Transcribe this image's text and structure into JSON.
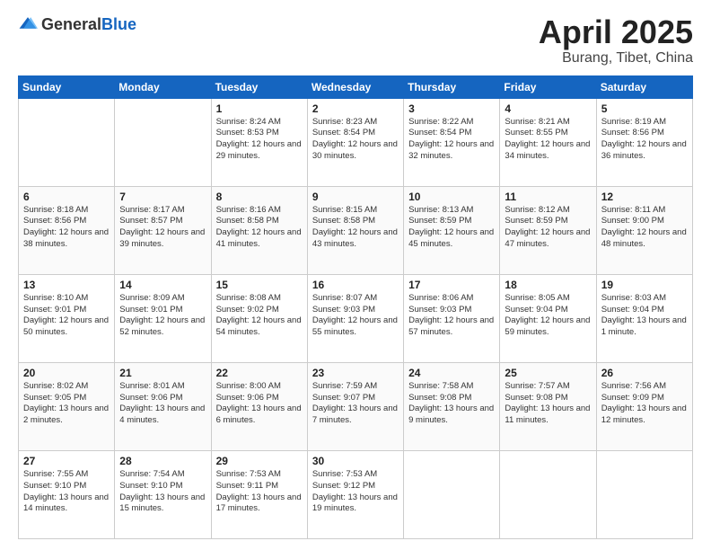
{
  "header": {
    "logo_general": "General",
    "logo_blue": "Blue",
    "title": "April 2025",
    "location": "Burang, Tibet, China"
  },
  "calendar": {
    "days_of_week": [
      "Sunday",
      "Monday",
      "Tuesday",
      "Wednesday",
      "Thursday",
      "Friday",
      "Saturday"
    ],
    "weeks": [
      [
        {
          "day": "",
          "info": ""
        },
        {
          "day": "",
          "info": ""
        },
        {
          "day": "1",
          "sunrise": "8:24 AM",
          "sunset": "8:53 PM",
          "daylight": "12 hours and 29 minutes."
        },
        {
          "day": "2",
          "sunrise": "8:23 AM",
          "sunset": "8:54 PM",
          "daylight": "12 hours and 30 minutes."
        },
        {
          "day": "3",
          "sunrise": "8:22 AM",
          "sunset": "8:54 PM",
          "daylight": "12 hours and 32 minutes."
        },
        {
          "day": "4",
          "sunrise": "8:21 AM",
          "sunset": "8:55 PM",
          "daylight": "12 hours and 34 minutes."
        },
        {
          "day": "5",
          "sunrise": "8:19 AM",
          "sunset": "8:56 PM",
          "daylight": "12 hours and 36 minutes."
        }
      ],
      [
        {
          "day": "6",
          "sunrise": "8:18 AM",
          "sunset": "8:56 PM",
          "daylight": "12 hours and 38 minutes."
        },
        {
          "day": "7",
          "sunrise": "8:17 AM",
          "sunset": "8:57 PM",
          "daylight": "12 hours and 39 minutes."
        },
        {
          "day": "8",
          "sunrise": "8:16 AM",
          "sunset": "8:58 PM",
          "daylight": "12 hours and 41 minutes."
        },
        {
          "day": "9",
          "sunrise": "8:15 AM",
          "sunset": "8:58 PM",
          "daylight": "12 hours and 43 minutes."
        },
        {
          "day": "10",
          "sunrise": "8:13 AM",
          "sunset": "8:59 PM",
          "daylight": "12 hours and 45 minutes."
        },
        {
          "day": "11",
          "sunrise": "8:12 AM",
          "sunset": "8:59 PM",
          "daylight": "12 hours and 47 minutes."
        },
        {
          "day": "12",
          "sunrise": "8:11 AM",
          "sunset": "9:00 PM",
          "daylight": "12 hours and 48 minutes."
        }
      ],
      [
        {
          "day": "13",
          "sunrise": "8:10 AM",
          "sunset": "9:01 PM",
          "daylight": "12 hours and 50 minutes."
        },
        {
          "day": "14",
          "sunrise": "8:09 AM",
          "sunset": "9:01 PM",
          "daylight": "12 hours and 52 minutes."
        },
        {
          "day": "15",
          "sunrise": "8:08 AM",
          "sunset": "9:02 PM",
          "daylight": "12 hours and 54 minutes."
        },
        {
          "day": "16",
          "sunrise": "8:07 AM",
          "sunset": "9:03 PM",
          "daylight": "12 hours and 55 minutes."
        },
        {
          "day": "17",
          "sunrise": "8:06 AM",
          "sunset": "9:03 PM",
          "daylight": "12 hours and 57 minutes."
        },
        {
          "day": "18",
          "sunrise": "8:05 AM",
          "sunset": "9:04 PM",
          "daylight": "12 hours and 59 minutes."
        },
        {
          "day": "19",
          "sunrise": "8:03 AM",
          "sunset": "9:04 PM",
          "daylight": "13 hours and 1 minute."
        }
      ],
      [
        {
          "day": "20",
          "sunrise": "8:02 AM",
          "sunset": "9:05 PM",
          "daylight": "13 hours and 2 minutes."
        },
        {
          "day": "21",
          "sunrise": "8:01 AM",
          "sunset": "9:06 PM",
          "daylight": "13 hours and 4 minutes."
        },
        {
          "day": "22",
          "sunrise": "8:00 AM",
          "sunset": "9:06 PM",
          "daylight": "13 hours and 6 minutes."
        },
        {
          "day": "23",
          "sunrise": "7:59 AM",
          "sunset": "9:07 PM",
          "daylight": "13 hours and 7 minutes."
        },
        {
          "day": "24",
          "sunrise": "7:58 AM",
          "sunset": "9:08 PM",
          "daylight": "13 hours and 9 minutes."
        },
        {
          "day": "25",
          "sunrise": "7:57 AM",
          "sunset": "9:08 PM",
          "daylight": "13 hours and 11 minutes."
        },
        {
          "day": "26",
          "sunrise": "7:56 AM",
          "sunset": "9:09 PM",
          "daylight": "13 hours and 12 minutes."
        }
      ],
      [
        {
          "day": "27",
          "sunrise": "7:55 AM",
          "sunset": "9:10 PM",
          "daylight": "13 hours and 14 minutes."
        },
        {
          "day": "28",
          "sunrise": "7:54 AM",
          "sunset": "9:10 PM",
          "daylight": "13 hours and 15 minutes."
        },
        {
          "day": "29",
          "sunrise": "7:53 AM",
          "sunset": "9:11 PM",
          "daylight": "13 hours and 17 minutes."
        },
        {
          "day": "30",
          "sunrise": "7:53 AM",
          "sunset": "9:12 PM",
          "daylight": "13 hours and 19 minutes."
        },
        {
          "day": "",
          "info": ""
        },
        {
          "day": "",
          "info": ""
        },
        {
          "day": "",
          "info": ""
        }
      ]
    ]
  }
}
